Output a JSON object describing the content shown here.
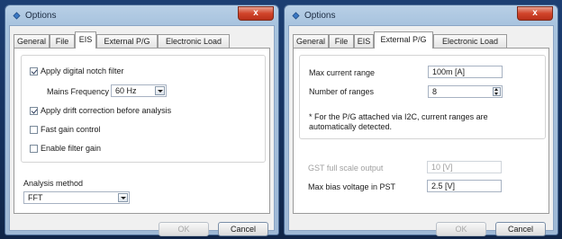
{
  "windows": [
    {
      "title": "Options",
      "close_glyph": "x",
      "tabs": [
        "General",
        "File",
        "EIS",
        "External P/G",
        "Electronic Load"
      ],
      "active_tab": "EIS",
      "panel": {
        "apply_notch_label": "Apply digital notch filter",
        "apply_notch_checked": true,
        "mains_frequency_label": "Mains Frequency",
        "mains_frequency_value": "60 Hz",
        "apply_drift_label": "Apply drift correction before analysis",
        "apply_drift_checked": true,
        "fast_gain_label": "Fast gain control",
        "fast_gain_checked": false,
        "enable_filter_gain_label": "Enable filter gain",
        "enable_filter_gain_checked": false,
        "analysis_method_label": "Analysis method",
        "analysis_method_value": "FFT"
      },
      "ok_label": "OK",
      "cancel_label": "Cancel"
    },
    {
      "title": "Options",
      "close_glyph": "x",
      "tabs": [
        "General",
        "File",
        "EIS",
        "External P/G",
        "Electronic Load"
      ],
      "active_tab": "External P/G",
      "panel": {
        "max_current_range_label": "Max current range",
        "max_current_range_value": "100m [A]",
        "number_of_ranges_label": "Number of ranges",
        "number_of_ranges_value": "8",
        "note_line1": "* For the P/G attached via I2C, current ranges are",
        "note_line2": "automatically detected.",
        "gst_output_label": "GST full scale output",
        "gst_output_value": "10 [V]",
        "max_bias_label": "Max bias voltage in PST",
        "max_bias_value": "2.5 [V]"
      },
      "ok_label": "OK",
      "cancel_label": "Cancel"
    }
  ]
}
